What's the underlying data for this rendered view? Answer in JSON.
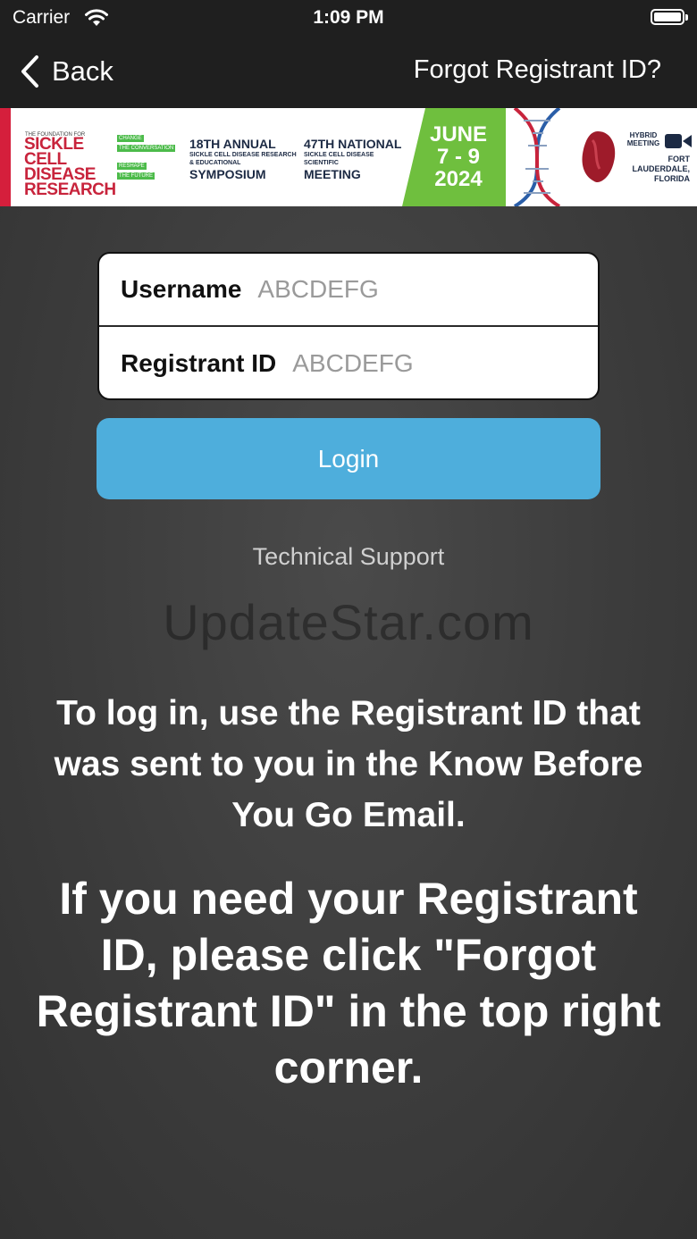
{
  "status_bar": {
    "carrier": "Carrier",
    "time": "1:09 PM"
  },
  "nav": {
    "back_label": "Back",
    "forgot_label": "Forgot Registrant ID?"
  },
  "banner": {
    "org_small": "THE FOUNDATION FOR",
    "org_lines": [
      "SICKLE CELL",
      "DISEASE",
      "RESEARCH"
    ],
    "tags": [
      "CHANGE",
      "THE CONVERSATION",
      "RESHAPE",
      "THE FUTURE"
    ],
    "symposium": {
      "title": "18TH ANNUAL",
      "sub": "SICKLE CELL DISEASE RESEARCH & EDUCATIONAL",
      "name": "SYMPOSIUM"
    },
    "meeting": {
      "title": "47TH NATIONAL",
      "sub": "SICKLE CELL DISEASE SCIENTIFIC",
      "name": "MEETING"
    },
    "date_lines": [
      "JUNE",
      "7 - 9",
      "2024"
    ],
    "hybrid": "HYBRID MEETING",
    "location_lines": [
      "FORT",
      "LAUDERDALE,",
      "FLORIDA"
    ],
    "colors": {
      "red": "#c8243c",
      "green": "#6fbf3e",
      "navy": "#1c2a44"
    }
  },
  "form": {
    "username_label": "Username",
    "username_placeholder": "ABCDEFG",
    "registrant_label": "Registrant ID",
    "registrant_placeholder": "ABCDEFG"
  },
  "login_label": "Login",
  "login_color": "#4eaedc",
  "support_label": "Technical Support",
  "watermark": "UpdateStar.com",
  "message1": "To log in, use the Registrant ID that was sent to you in the Know Before You Go Email.",
  "message2": "If you need your Registrant ID, please click \"Forgot Registrant ID\" in the top right corner."
}
